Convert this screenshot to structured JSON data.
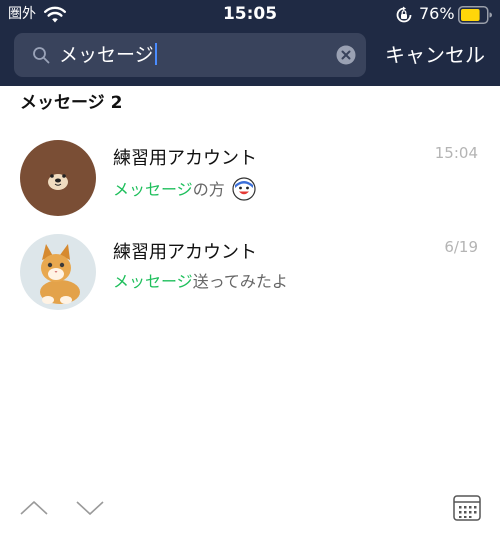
{
  "status_bar": {
    "carrier": "圏外",
    "time": "15:05",
    "battery_pct": "76%",
    "battery_level": 0.76,
    "battery_color": "#ffd60a"
  },
  "search": {
    "query": "メッセージ",
    "cancel_label": "キャンセル"
  },
  "section": {
    "title": "メッセージ 2"
  },
  "results": [
    {
      "name": "練習用アカウント",
      "match": "メッセージ",
      "rest": "の方",
      "time": "15:04",
      "avatar": "brown-bear",
      "has_sticker": true
    },
    {
      "name": "練習用アカウント",
      "match": "メッセージ",
      "rest": "送ってみたよ",
      "time": "6/19",
      "avatar": "kitten",
      "has_sticker": false
    }
  ],
  "colors": {
    "header_bg": "#1f2a44",
    "search_bg": "#39435c",
    "highlight": "#1fbf5c",
    "caret": "#4a8cff"
  },
  "icons": {
    "wifi": "wifi-icon",
    "orientation_lock": "rotation-lock-icon",
    "search": "search-icon",
    "clear": "clear-icon",
    "up": "chevron-up-icon",
    "down": "chevron-down-icon",
    "calendar": "calendar-icon"
  }
}
